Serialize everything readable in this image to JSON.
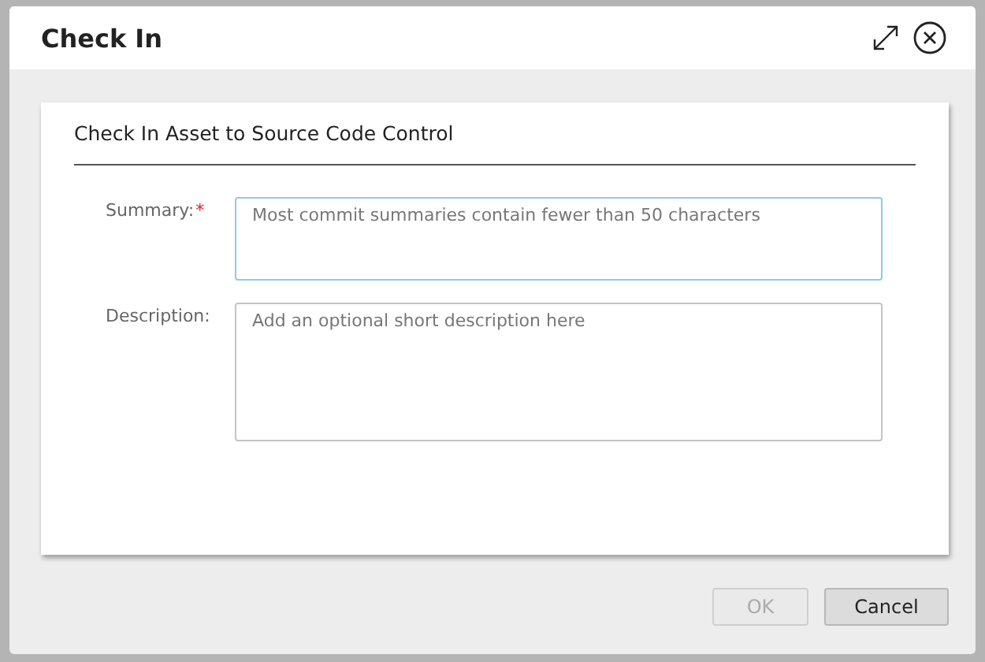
{
  "dialog": {
    "title": "Check In"
  },
  "section": {
    "title": "Check In Asset to Source Code Control"
  },
  "fields": [
    {
      "label": "Summary:",
      "required_mark": "*",
      "placeholder": "Most commit summaries contain fewer than 50 characters",
      "focused": true
    },
    {
      "label": "Description:",
      "placeholder": "Add an optional short description here",
      "focused": false
    }
  ],
  "buttons": [
    {
      "label": "OK",
      "disabled": true
    },
    {
      "label": "Cancel",
      "disabled": false
    }
  ]
}
